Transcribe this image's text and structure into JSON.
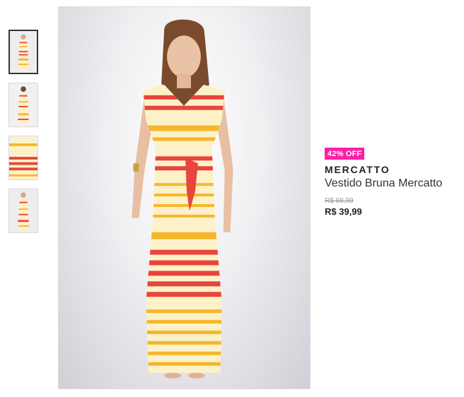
{
  "gallery": {
    "thumbnails": [
      {
        "label": "product-photo-front-full",
        "active": true
      },
      {
        "label": "product-photo-back",
        "active": false
      },
      {
        "label": "product-photo-detail",
        "active": false
      },
      {
        "label": "product-photo-full-2",
        "active": false
      }
    ],
    "main_image": "product-photo-front-full"
  },
  "product": {
    "discount_badge": "42% OFF",
    "brand": "MERCATTO",
    "name": "Vestido Bruna Mercatto",
    "old_price": "R$ 69,99",
    "price": "R$ 39,99"
  },
  "colors": {
    "badge": "#ff1ea8",
    "stripe_red": "#e8453c",
    "stripe_yellow": "#f6b62c",
    "dress_base": "#fdf1c8"
  }
}
